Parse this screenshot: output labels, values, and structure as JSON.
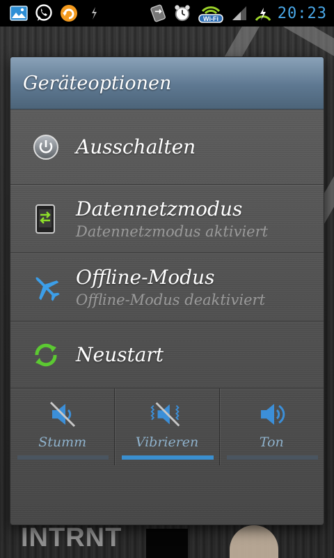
{
  "status_bar": {
    "time": "20:23",
    "icons_left": [
      "gallery-icon",
      "whatsapp-icon",
      "sync-icon",
      "usb-icon"
    ],
    "icons_right": [
      "data-transfer-icon",
      "alarm-icon",
      "wifi-icon",
      "signal-icon",
      "battery-charging-icon"
    ],
    "wifi_label": "Wi-Fi",
    "accent_color": "#4aa8e8"
  },
  "background": {
    "text": "INTRNT"
  },
  "dialog": {
    "title": "Geräteoptionen",
    "options": [
      {
        "label": "Ausschalten",
        "subtitle": "",
        "icon": "power-icon"
      },
      {
        "label": "Datennetzmodus",
        "subtitle": "Datennetzmodus aktiviert",
        "icon": "mobile-data-icon"
      },
      {
        "label": "Offline-Modus",
        "subtitle": "Offline-Modus deaktiviert",
        "icon": "airplane-icon"
      },
      {
        "label": "Neustart",
        "subtitle": "",
        "icon": "restart-icon"
      }
    ],
    "sound_profiles": [
      {
        "label": "Stumm",
        "icon": "mute-icon",
        "active": false
      },
      {
        "label": "Vibrieren",
        "icon": "vibrate-icon",
        "active": true
      },
      {
        "label": "Ton",
        "icon": "sound-icon",
        "active": false
      }
    ]
  }
}
